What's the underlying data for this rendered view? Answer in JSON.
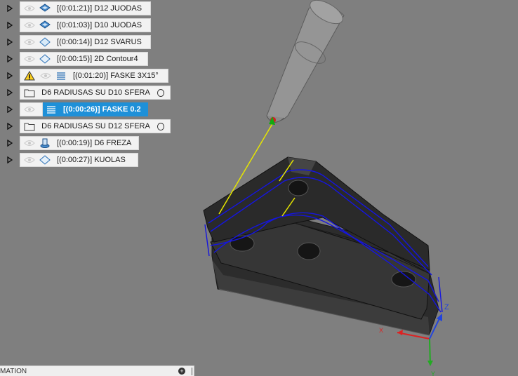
{
  "browser_tree": {
    "items": [
      {
        "label": "[(0:01:21)] D12 JUODAS",
        "type": "operation",
        "icon": "adaptive-clearing-icon"
      },
      {
        "label": "[(0:01:03)] D10 JUODAS",
        "type": "operation",
        "icon": "adaptive-clearing-icon"
      },
      {
        "label": "[(0:00:14)] D12 SVARUS",
        "type": "operation",
        "icon": "pocket-icon"
      },
      {
        "label": "[(0:00:15)] 2D Contour4",
        "type": "operation",
        "icon": "contour-icon"
      },
      {
        "label": "[(0:01:20)] FASKE 3X15°",
        "type": "operation",
        "icon": "scallop-icon",
        "warning": true
      },
      {
        "label": "D6 RADIUSAS SU D10 SFERA",
        "type": "folder"
      },
      {
        "label": "[(0:00:26)] FASKE 0.2",
        "type": "operation",
        "icon": "scallop-icon",
        "selected": true
      },
      {
        "label": "D6 RADIUSAS SU D12 SFERA",
        "type": "folder"
      },
      {
        "label": "[(0:00:19)] D6 FREZA",
        "type": "operation",
        "icon": "drill-icon"
      },
      {
        "label": "[(0:00:27)] KUOLAS",
        "type": "operation",
        "icon": "contour-icon"
      }
    ]
  },
  "bottom_panel": {
    "label": "MATION"
  },
  "axes": {
    "z_label": "Z",
    "x_label": "X",
    "y_label": "Y"
  },
  "colors": {
    "viewport_bg": "#7f7f7f",
    "selected": "#1e90d8",
    "toolpath": "#1515e0",
    "lead": "#e6e600"
  }
}
